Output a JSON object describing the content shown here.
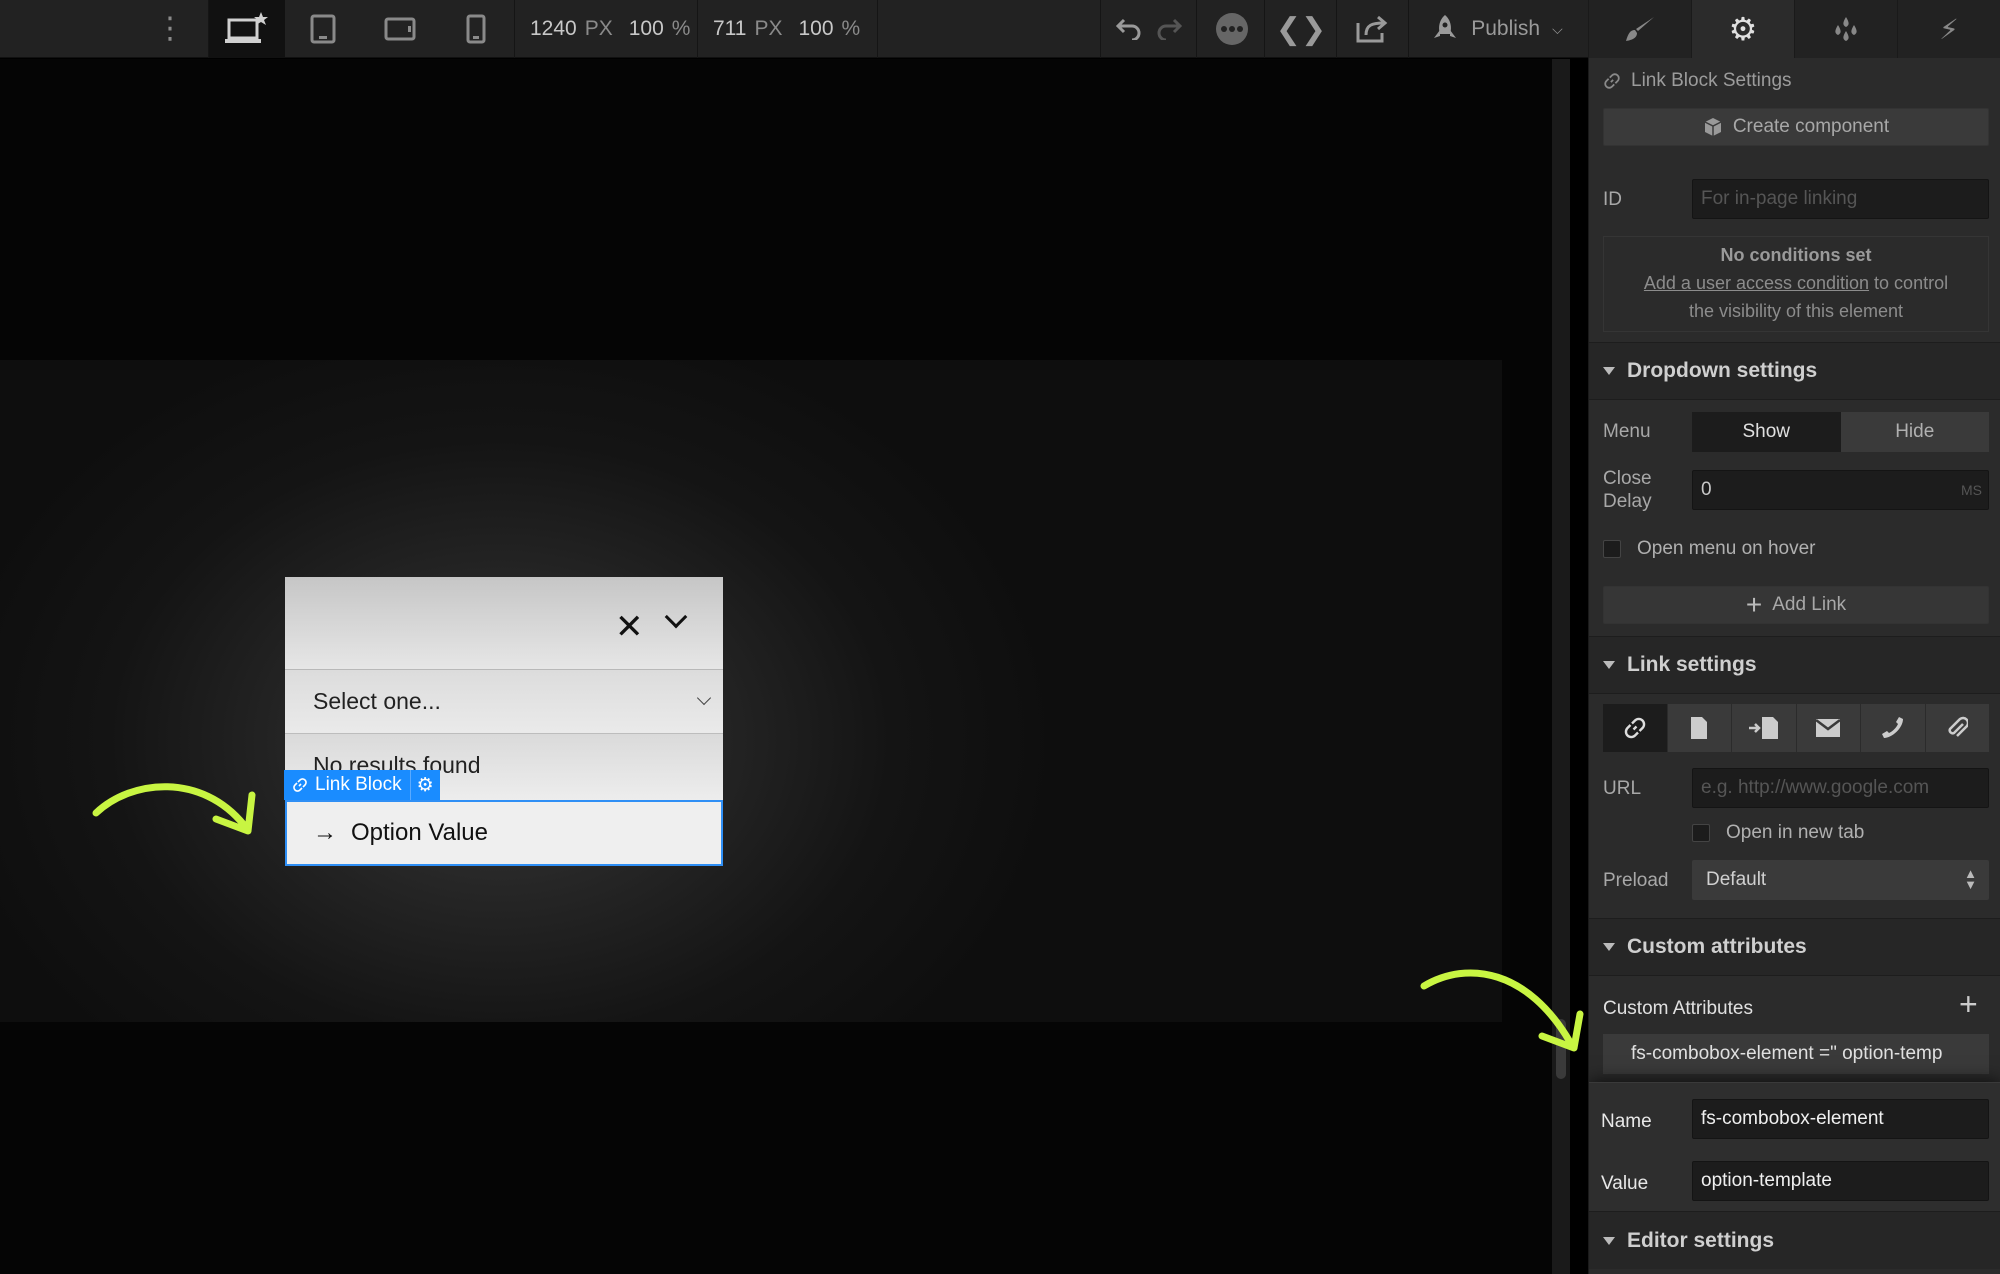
{
  "toolbar": {
    "width_value": "1240",
    "width_unit": "PX",
    "width_pct": "100",
    "pct_sign": "%",
    "height_value": "711",
    "height_unit": "PX",
    "height_pct": "100",
    "pct_sign2": "%",
    "publish_label": "Publish"
  },
  "canvas": {
    "select_placeholder": "Select one...",
    "no_results": "No results found",
    "option_value": "Option Value",
    "option_arrow": "→",
    "selection_tag": "Link Block"
  },
  "panel": {
    "tabs": [
      "style",
      "settings",
      "interactions",
      "lightning"
    ],
    "element_title": "Link Block Settings",
    "create_component": "Create component",
    "id_label": "ID",
    "id_placeholder": "For in-page linking",
    "conditions_title": "No conditions set",
    "conditions_link": "Add a user access condition",
    "conditions_rest1": " to control",
    "conditions_rest2": "the visibility of this element",
    "dropdown_section": "Dropdown settings",
    "menu_label": "Menu",
    "menu_show": "Show",
    "menu_hide": "Hide",
    "close_label": "Close",
    "delay_label": "Delay",
    "close_delay_value": "0",
    "close_delay_unit": "MS",
    "open_on_hover": "Open menu on hover",
    "add_link": "Add Link",
    "link_section": "Link settings",
    "url_label": "URL",
    "url_placeholder": "e.g. http://www.google.com",
    "open_new_tab": "Open in new tab",
    "preload_label": "Preload",
    "preload_value": "Default",
    "custom_section": "Custom attributes",
    "custom_attributes_label": "Custom Attributes",
    "attribute_row": "fs-combobox-element =\" option-temp",
    "name_label": "Name",
    "name_value": "fs-combobox-element",
    "value_label": "Value",
    "value_value": "option-template",
    "editor_section": "Editor settings"
  },
  "colors": {
    "accent_blue": "#1a8cff",
    "annotation_arrow": "#c8f542"
  }
}
